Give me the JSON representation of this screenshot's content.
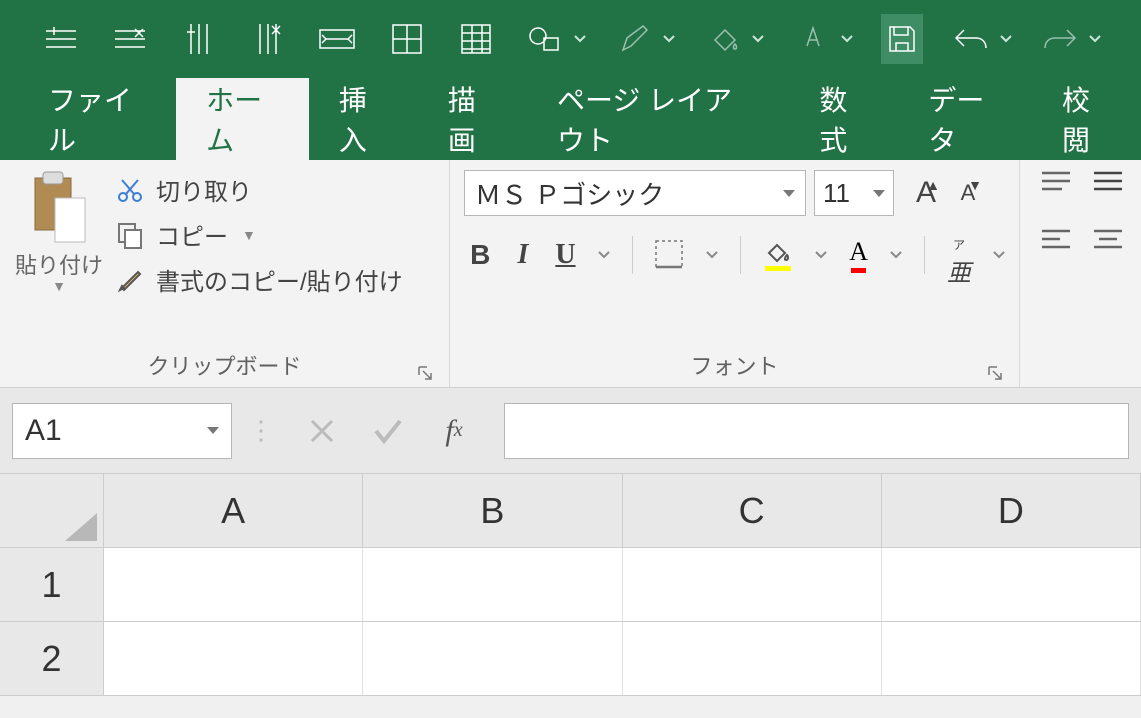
{
  "qat": {
    "buttons": [
      "insert-rows",
      "delete-rows",
      "insert-cols",
      "delete-cols",
      "autofit",
      "borders",
      "table",
      "shapes",
      "pen",
      "bucket",
      "font-color",
      "save",
      "undo",
      "redo"
    ]
  },
  "tabs": {
    "items": [
      "ファイル",
      "ホーム",
      "挿入",
      "描画",
      "ページ レイアウト",
      "数式",
      "データ",
      "校閲"
    ],
    "active_index": 1
  },
  "clipboard": {
    "paste_label": "貼り付け",
    "cut_label": "切り取り",
    "copy_label": "コピー",
    "format_painter_label": "書式のコピー/貼り付け",
    "group_label": "クリップボード"
  },
  "font": {
    "name": "ＭＳ Ｐゴシック",
    "size": "11",
    "group_label": "フォント",
    "fill_color": "#ffff00",
    "font_color": "#ff0000"
  },
  "formula_bar": {
    "cell_ref": "A1",
    "formula": ""
  },
  "grid": {
    "columns": [
      "A",
      "B",
      "C",
      "D"
    ],
    "rows": [
      "1",
      "2"
    ]
  }
}
